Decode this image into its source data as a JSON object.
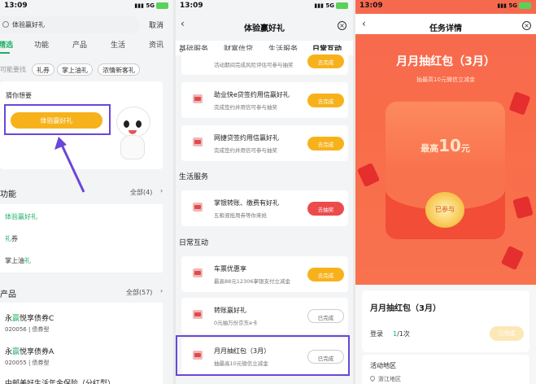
{
  "status": {
    "time": "13:09",
    "network": "5G"
  },
  "search_screen": {
    "search_text": "体验赢好礼",
    "cancel": "取消",
    "tabs": [
      "精选",
      "功能",
      "产品",
      "生活",
      "资讯"
    ],
    "hint": "可能要找",
    "chips": [
      "礼券",
      "掌上油礼",
      "浓情新客礼"
    ],
    "wish_title": "猜你想要",
    "wish_button": "体验赢好礼",
    "func_title": "功能",
    "func_more": "全部(4)",
    "func_items": [
      {
        "pre": "",
        "hl": "体验赢好礼",
        "post": ""
      },
      {
        "pre": "",
        "hl": "礼",
        "post": "券"
      },
      {
        "pre": "掌上油",
        "hl": "礼",
        "post": ""
      }
    ],
    "prod_title": "产品",
    "prod_more": "全部(57)",
    "products": [
      {
        "pre": "永",
        "hl": "赢",
        "post": "悦享债券C",
        "sub": "020056 | 债券型"
      },
      {
        "pre": "永",
        "hl": "赢",
        "post": "悦享债券A",
        "sub": "020055 | 债券型"
      },
      {
        "pre": "",
        "hl": "",
        "post": "中邮美好生活年金保险（分红型）",
        "sub": ""
      }
    ]
  },
  "experience_screen": {
    "title": "体验赢好礼",
    "tabs": [
      "基础服务",
      "财富信贷",
      "生活服务",
      "日常互动"
    ],
    "active_tab": "日常互动",
    "tasks_top": [
      {
        "name": "",
        "desc": "活动期间完成风险评估可参与抽奖",
        "button": "去完成"
      },
      {
        "name": "助业快e贷签约用信赢好礼",
        "desc": "完成签约并用信可参与抽奖",
        "button": "去完成"
      },
      {
        "name": "网捷贷签约用信赢好礼",
        "desc": "完成签约并用信可参与抽奖",
        "button": "去完成"
      }
    ],
    "life_title": "生活服务",
    "life_tasks": [
      {
        "name": "掌银转账、缴费有好礼",
        "desc": "五粮液抵用券等你来抢",
        "button": "去抽奖"
      }
    ],
    "daily_title": "日常互动",
    "daily_tasks": [
      {
        "name": "车票优惠享",
        "desc": "最高88元12306掌银支付立减金",
        "button": "去完成"
      },
      {
        "name": "转账赢好礼",
        "desc": "0元抽万份京东e卡",
        "button": "已完成"
      },
      {
        "name": "月月抽红包（3月）",
        "desc": "抽最高10元微信立减金",
        "button": "已完成"
      }
    ]
  },
  "task_detail": {
    "title": "任务详情",
    "banner_title": "月月抽红包（3月）",
    "banner_sub": "抽最高10元微信立减金",
    "envelope_prefix": "最高",
    "envelope_amount": "10",
    "envelope_unit": "元",
    "coin_label": "已参与",
    "card_title": "月月抽红包（3月）",
    "login_label": "登录",
    "progress_done": "1",
    "progress_total": "/1次",
    "done_button": "已完成",
    "area_title": "活动地区",
    "area_value": "浙江地区"
  }
}
